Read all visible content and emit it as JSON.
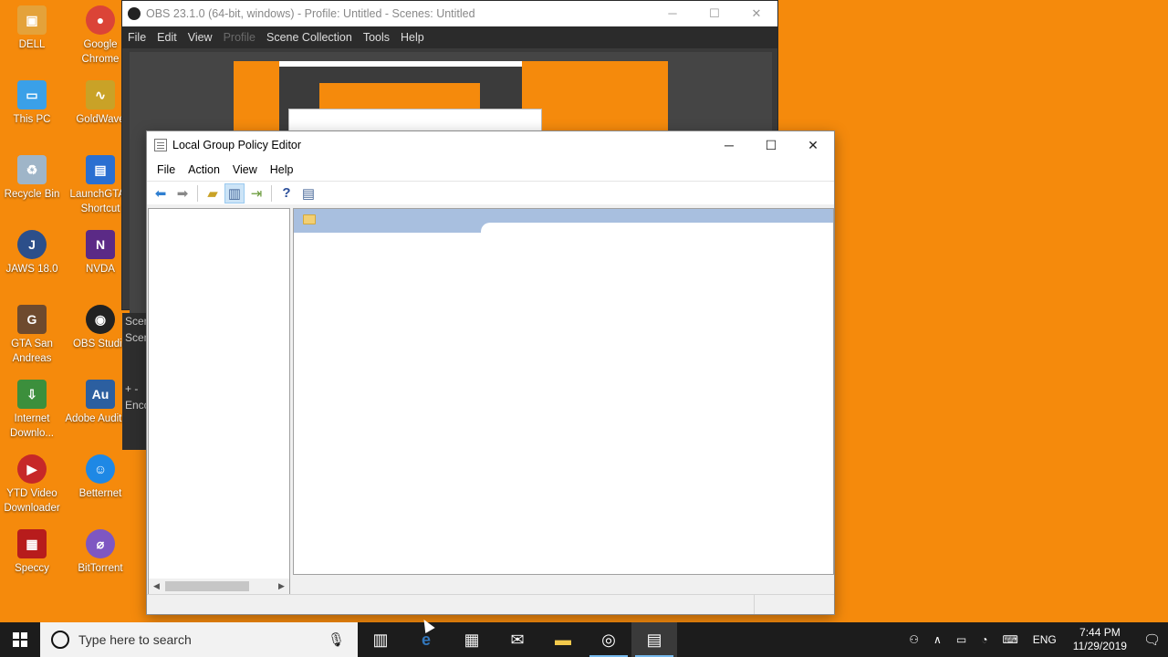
{
  "desktop": {
    "icons": [
      {
        "label": "DELL",
        "icon": "dell-folder-icon",
        "color": "#e4a23a"
      },
      {
        "label": "Google Chrome",
        "icon": "chrome-icon",
        "color": "#db4437"
      },
      {
        "label": "This PC",
        "icon": "computer-icon",
        "color": "#3aa0e8"
      },
      {
        "label": "GoldWave",
        "icon": "goldwave-icon",
        "color": "#c9a227"
      },
      {
        "label": "Recycle Bin",
        "icon": "recycle-bin-icon",
        "color": "#9fb5c8"
      },
      {
        "label": "LaunchGTA - Shortcut",
        "icon": "launch-gta-icon",
        "color": "#2a6fd1"
      },
      {
        "label": "JAWS 18.0",
        "icon": "jaws-icon",
        "color": "#2c4f8a"
      },
      {
        "label": "NVDA",
        "icon": "nvda-icon",
        "color": "#5b2a86"
      },
      {
        "label": "GTA San Andreas",
        "icon": "gta-icon",
        "color": "#6e4a2e"
      },
      {
        "label": "OBS Studio",
        "icon": "obs-icon",
        "color": "#222222"
      },
      {
        "label": "Internet Downlo...",
        "icon": "idm-icon",
        "color": "#3c8f3c"
      },
      {
        "label": "Adobe Audition",
        "icon": "adobe-audition-icon",
        "color": "#2c5fa0"
      },
      {
        "label": "YTD Video Downloader",
        "icon": "ytd-icon",
        "color": "#c62828"
      },
      {
        "label": "Betternet",
        "icon": "betternet-icon",
        "color": "#1e88e5"
      },
      {
        "label": "Speccy",
        "icon": "speccy-icon",
        "color": "#b71c1c"
      },
      {
        "label": "BitTorrent",
        "icon": "bittorrent-icon",
        "color": "#7e57c2"
      }
    ]
  },
  "obs": {
    "title": "OBS 23.1.0 (64-bit, windows) - Profile: Untitled - Scenes: Untitled",
    "menu": [
      "File",
      "Edit",
      "View",
      "Profile",
      "Scene Collection",
      "Tools",
      "Help"
    ],
    "side": [
      "Scen",
      "Scen",
      "+ -",
      "Enco"
    ]
  },
  "gpe": {
    "title": "Local Group Policy Editor",
    "menu": [
      "File",
      "Action",
      "View",
      "Help"
    ],
    "toolbar": [
      "back-arrow-icon",
      "forward-arrow-icon",
      "up-folder-icon",
      "show-hide-tree-icon",
      "export-list-icon",
      "help-icon",
      "properties-pane-icon"
    ],
    "controls": {
      "minimize": "─",
      "maximize": "☐",
      "close": "✕"
    }
  },
  "taskbar": {
    "search_placeholder": "Type here to search",
    "apps": [
      "task-view-icon",
      "edge-icon",
      "store-icon",
      "mail-icon",
      "file-explorer-icon",
      "obs-taskbar-icon",
      "group-policy-taskbar-icon"
    ],
    "language": "ENG",
    "time": "7:44 PM",
    "date": "11/29/2019"
  }
}
